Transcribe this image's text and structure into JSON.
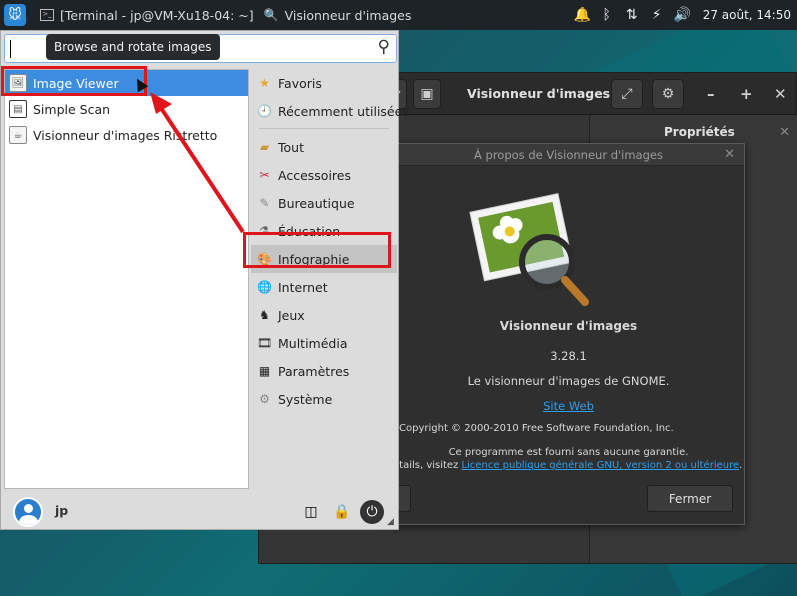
{
  "panel": {
    "tasks": [
      {
        "icon": "terminal-icon",
        "label": "[Terminal - jp@VM-Xu18-04: ~]"
      },
      {
        "icon": "image-viewer-icon",
        "label": "Visionneur d'images"
      }
    ],
    "clock": "27 août, 14:50"
  },
  "menu": {
    "tooltip": "Browse and rotate images",
    "search_value": "",
    "apps": [
      {
        "label": "Image Viewer",
        "selected": true
      },
      {
        "label": "Simple Scan",
        "selected": false
      },
      {
        "label": "Visionneur d'images Ristretto",
        "selected": false
      }
    ],
    "categories": [
      {
        "label": "Favoris",
        "icon": "star-icon"
      },
      {
        "label": "Récemment utilisées",
        "icon": "recent-icon"
      },
      {
        "label": "Tout",
        "icon": "folder-icon"
      },
      {
        "label": "Accessoires",
        "icon": "accessories-icon"
      },
      {
        "label": "Bureautique",
        "icon": "office-icon"
      },
      {
        "label": "Éducation",
        "icon": "education-icon"
      },
      {
        "label": "Infographie",
        "icon": "graphics-icon",
        "highlighted": true
      },
      {
        "label": "Internet",
        "icon": "globe-icon"
      },
      {
        "label": "Jeux",
        "icon": "games-icon"
      },
      {
        "label": "Multimédia",
        "icon": "multimedia-icon"
      },
      {
        "label": "Paramètres",
        "icon": "settings-icon"
      },
      {
        "label": "Système",
        "icon": "system-icon"
      }
    ],
    "user": "jp"
  },
  "window": {
    "title": "Visionneur d'images",
    "side_title": "Propriétés"
  },
  "about": {
    "title": "À propos de Visionneur d'images",
    "app_name": "Visionneur d'images",
    "version": "3.28.1",
    "description": "Le visionneur d'images de GNOME.",
    "website": "Site Web",
    "copyright": "Copyright © 2000-2010 Free Software Foundation, Inc.",
    "warranty_line1": "Ce programme est fourni sans aucune garantie.",
    "warranty_line2_prefix": "etails, visitez ",
    "license_link": "Licence publique générale GNU, version 2 ou ultérieure",
    "warranty_line2_suffix": ".",
    "close_label": "Fermer"
  },
  "colors": {
    "highlight_box": "#e0141b",
    "selection": "#3c8ce0",
    "link": "#2c9ff0"
  }
}
